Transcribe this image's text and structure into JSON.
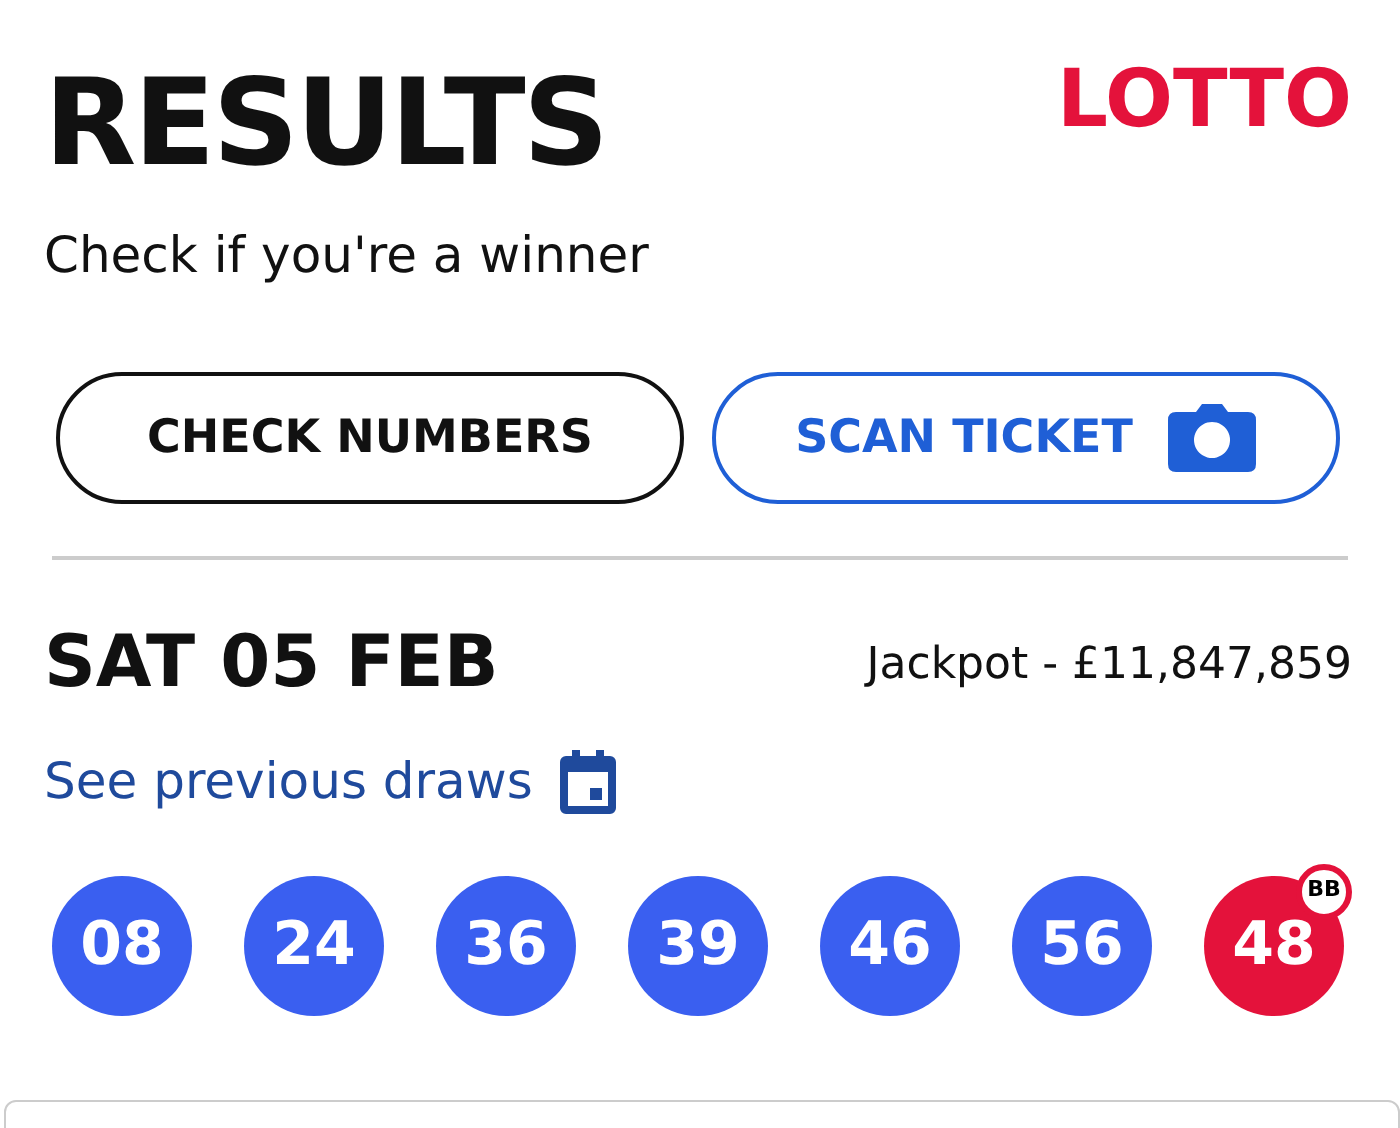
{
  "header": {
    "title": "RESULTS",
    "logo": "LOTTO",
    "subtitle": "Check if you're a winner"
  },
  "buttons": [
    {
      "label": "CHECK NUMBERS",
      "kind": "outline"
    },
    {
      "label": "SCAN TICKET",
      "kind": "camera"
    }
  ],
  "draw": {
    "date": "SAT 05 FEB",
    "jackpot": "Jackpot - £11,847,859",
    "previous_link": "See previous draws",
    "balls": [
      {
        "number": "08",
        "kind": "main",
        "color": "#3a5ff0"
      },
      {
        "number": "24",
        "kind": "main",
        "color": "#3a5ff0"
      },
      {
        "number": "36",
        "kind": "main",
        "color": "#3a5ff0"
      },
      {
        "number": "39",
        "kind": "main",
        "color": "#3a5ff0"
      },
      {
        "number": "46",
        "kind": "main",
        "color": "#3a5ff0"
      },
      {
        "number": "56",
        "kind": "main",
        "color": "#3a5ff0"
      },
      {
        "number": "48",
        "kind": "bonus",
        "color": "#e4123b",
        "badge": "BB"
      }
    ]
  }
}
